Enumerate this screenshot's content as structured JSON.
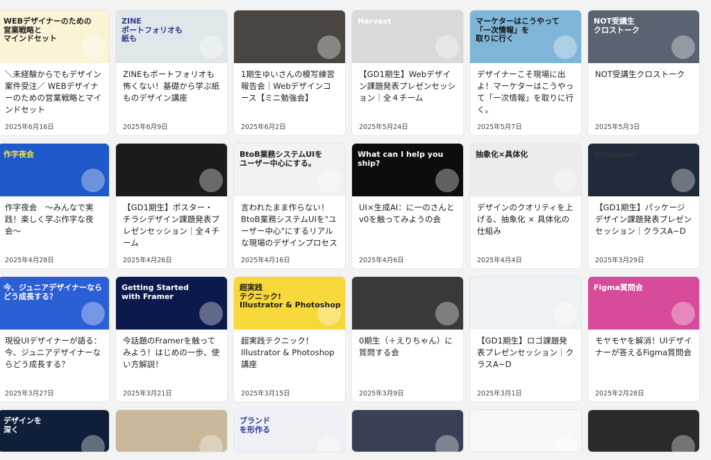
{
  "articles": [
    {
      "title": "＼未経験からでもデザイン案件受注／ WEBデザイナーのための営業戦略とマインドセット",
      "date": "2025年6月16日",
      "thumb_bg": "#fbf3d6",
      "thumb_text": "WEBデザイナーのための\n営業戦略と\nマインドセット",
      "thumb_fg": "#1c1c1c"
    },
    {
      "title": "ZINEもポートフォリオも怖くない！基礎から学ぶ紙ものデザイン講座",
      "date": "2025年6月9日",
      "thumb_bg": "#dfe7ea",
      "thumb_text": "ZINE\nポートフォリオも\n紙も",
      "thumb_fg": "#2a3c8f"
    },
    {
      "title": "1期生ゆいさんの模写練習報告会｜Webデザインコース【ミニ勉強会】",
      "date": "2025年6月2日",
      "thumb_bg": "#4a4540",
      "thumb_text": "",
      "thumb_fg": "#ffffff"
    },
    {
      "title": "【GD1期生】Webデザイン課題発表プレゼンセッション｜全４チーム",
      "date": "2025年5月24日",
      "thumb_bg": "#d9d9d9",
      "thumb_text": "Harvest",
      "thumb_fg": "#ffffff"
    },
    {
      "title": "デザイナーこそ現場に出よ！マーケターはこうやって「一次情報」を取りに行く。",
      "date": "2025年5月7日",
      "thumb_bg": "#7fb6d8",
      "thumb_text": "マーケターはこうやって\n「一次情報」を\n取りに行く",
      "thumb_fg": "#111111"
    },
    {
      "title": "NOT受講生クロストーク",
      "date": "2025年5月3日",
      "thumb_bg": "#5a6470",
      "thumb_text": "NOT受講生\nクロストーク",
      "thumb_fg": "#ffffff"
    },
    {
      "title": "作字夜会　〜みんなで実践！楽しく学ぶ作字な夜会〜",
      "date": "2025年4月28日",
      "thumb_bg": "#1f58c9",
      "thumb_text": "作字夜会",
      "thumb_fg": "#f6e84a"
    },
    {
      "title": "【GD1期生】ポスター・チラシデザイン課題発表プレゼンセッション｜全４チーム",
      "date": "2025年4月26日",
      "thumb_bg": "#1b1b1b",
      "thumb_text": "",
      "thumb_fg": "#ffffff"
    },
    {
      "title": "言われたまま作らない！BtoB業務システムUIを\"ユーザー中心\"にするリアルな現場のデザインプロセス",
      "date": "2025年4月16日",
      "thumb_bg": "#f2f2f2",
      "thumb_text": "BtoB業務システムUIを\nユーザー中心にする。",
      "thumb_fg": "#1c1c1c"
    },
    {
      "title": "UI×生成AI：に一のさんとv0を触ってみようの会",
      "date": "2025年4月6日",
      "thumb_bg": "#0d0d0f",
      "thumb_text": "What can I help you ship?",
      "thumb_fg": "#ffffff"
    },
    {
      "title": "デザインのクオリティを上げる、抽象化 × 具体化の仕組み",
      "date": "2025年4月4日",
      "thumb_bg": "#ececec",
      "thumb_text": "抽象化×具体化",
      "thumb_fg": "#1c1c1c"
    },
    {
      "title": "【GD1期生】パッケージデザイン課題発表プレゼンセッション｜クラスA~D",
      "date": "2025年3月29日",
      "thumb_bg": "#1f2b3a",
      "thumb_text": "Welcome!",
      "thumb_fg": "#333333"
    },
    {
      "title": "現役UIデザイナーが語る：今、ジュニアデザイナーならどう成長する？",
      "date": "2025年3月27日",
      "thumb_bg": "#2b5fd6",
      "thumb_text": "今、ジュニアデザイナーならどう成長する？",
      "thumb_fg": "#ffffff"
    },
    {
      "title": "今話題のFramerを触ってみよう！はじめの一歩、使い方解説！",
      "date": "2025年3月21日",
      "thumb_bg": "#0b1a4a",
      "thumb_text": "Getting Started\nwith Framer",
      "thumb_fg": "#ffffff"
    },
    {
      "title": "超実践テクニック！Illustrator & Photoshop講座",
      "date": "2025年3月15日",
      "thumb_bg": "#f6d83a",
      "thumb_text": "超実践\nテクニック!\nIllustrator & Photoshop",
      "thumb_fg": "#1c1c1c"
    },
    {
      "title": "0期生（＋えりちゃん）に質問する会",
      "date": "2025年3月9日",
      "thumb_bg": "#3a3a3c",
      "thumb_text": "",
      "thumb_fg": "#ffffff"
    },
    {
      "title": "【GD1期生】ロゴ課題発表プレゼンセッション｜クラスA~D",
      "date": "2025年3月1日",
      "thumb_bg": "#eef2f4",
      "thumb_text": "",
      "thumb_fg": "#333333"
    },
    {
      "title": "モヤモヤを解消！UIデザイナーが答えるFigma質問会",
      "date": "2025年2月28日",
      "thumb_bg": "#d84a9a",
      "thumb_text": "Figma質問会",
      "thumb_fg": "#ffffff"
    },
    {
      "title": "",
      "date": "",
      "thumb_bg": "#0f1f3a",
      "thumb_text": "デザインを\n深く",
      "thumb_fg": "#ffffff"
    },
    {
      "title": "",
      "date": "",
      "thumb_bg": "#c9b99a",
      "thumb_text": "",
      "thumb_fg": "#ffffff"
    },
    {
      "title": "",
      "date": "",
      "thumb_bg": "#eef0f6",
      "thumb_text": "ブランド\nを形作る",
      "thumb_fg": "#2a3c8f"
    },
    {
      "title": "",
      "date": "",
      "thumb_bg": "#3a3f55",
      "thumb_text": "",
      "thumb_fg": "#ffffff"
    },
    {
      "title": "",
      "date": "",
      "thumb_bg": "#f7f7f7",
      "thumb_text": "",
      "thumb_fg": "#333333"
    },
    {
      "title": "",
      "date": "",
      "thumb_bg": "#2a2a2c",
      "thumb_text": "",
      "thumb_fg": "#ffffff"
    }
  ]
}
